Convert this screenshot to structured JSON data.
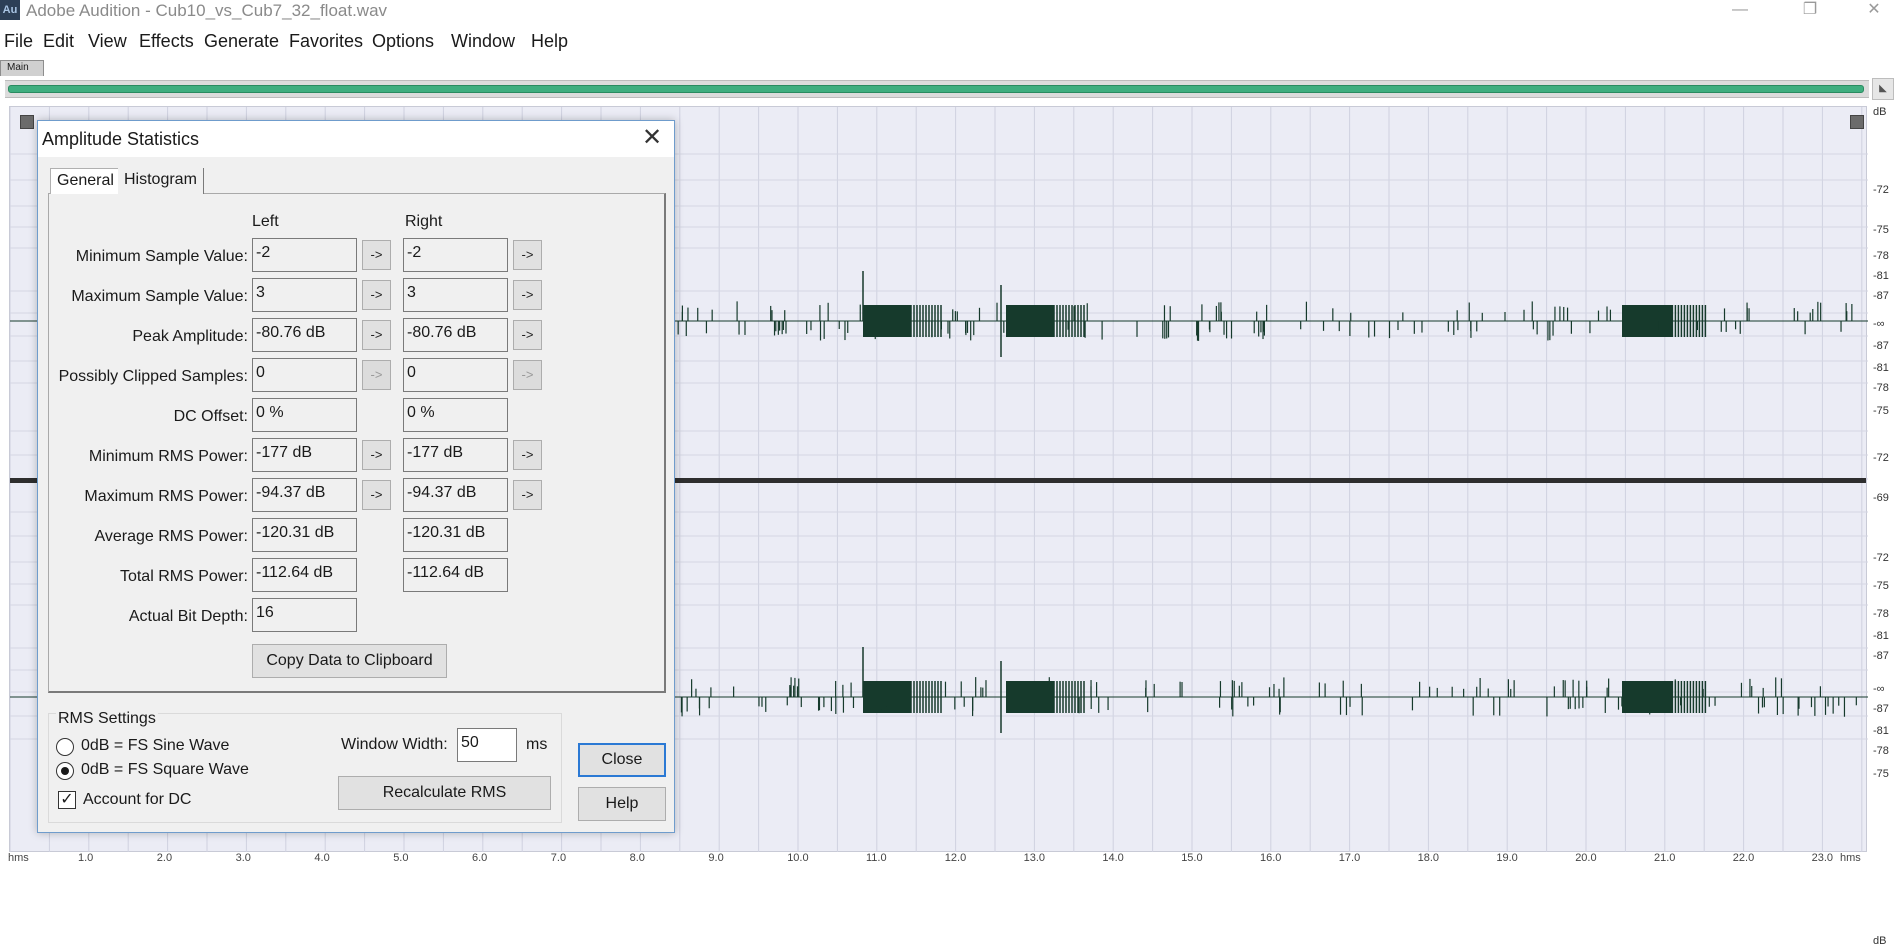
{
  "app": {
    "icon_text": "Au",
    "title": "Adobe Audition - Cub10_vs_Cub7_32_float.wav"
  },
  "window_controls": {
    "minimize": "—",
    "restore": "❐",
    "close": "✕"
  },
  "menu": [
    "File",
    "Edit",
    "View",
    "Effects",
    "Generate",
    "Favorites",
    "Options",
    "Window",
    "Help"
  ],
  "main_tab": "Main",
  "db_ruler": {
    "top_unit": "dB",
    "bottom_unit": "dB",
    "labels": [
      "-72",
      "-75",
      "-78",
      "-81",
      "-87",
      "-∞",
      "-87",
      "-81",
      "-78",
      "-75",
      "-72",
      "-69",
      "-72",
      "-75",
      "-78",
      "-81",
      "-87",
      "-∞",
      "-87",
      "-81",
      "-78",
      "-75"
    ]
  },
  "time_ruler": {
    "labels": [
      "hms",
      "1.0",
      "2.0",
      "3.0",
      "4.0",
      "5.0",
      "6.0",
      "7.0",
      "8.0",
      "9.0",
      "10.0",
      "11.0",
      "12.0",
      "13.0",
      "14.0",
      "15.0",
      "16.0",
      "17.0",
      "18.0",
      "19.0",
      "20.0",
      "21.0",
      "22.0",
      "23.0",
      "hms"
    ]
  },
  "colors": {
    "waveform": "#163a2c",
    "waveform_background": "#ebecf5",
    "overview_range": "#3fae7f",
    "focus_border": "#2b79d4"
  },
  "dialog": {
    "title": "Amplitude Statistics",
    "close_glyph": "✕",
    "tabs": [
      "General",
      "Histogram"
    ],
    "columns": {
      "left": "Left",
      "right": "Right"
    },
    "rows": [
      {
        "label": "Minimum Sample Value:",
        "left": "-2",
        "right": "-2",
        "arrow": "->",
        "arrow_enabled": true
      },
      {
        "label": "Maximum Sample Value:",
        "left": "3",
        "right": "3",
        "arrow": "->",
        "arrow_enabled": true
      },
      {
        "label": "Peak Amplitude:",
        "left": "-80.76 dB",
        "right": "-80.76 dB",
        "arrow": "->",
        "arrow_enabled": true
      },
      {
        "label": "Possibly Clipped Samples:",
        "left": "0",
        "right": "0",
        "arrow": "->",
        "arrow_enabled": false
      },
      {
        "label": "DC Offset:",
        "left": "0 %",
        "right": "0 %",
        "arrow": "",
        "arrow_enabled": false
      },
      {
        "label": "Minimum RMS Power:",
        "left": "-177 dB",
        "right": "-177 dB",
        "arrow": "->",
        "arrow_enabled": true
      },
      {
        "label": "Maximum RMS Power:",
        "left": "-94.37 dB",
        "right": "-94.37 dB",
        "arrow": "->",
        "arrow_enabled": true
      },
      {
        "label": "Average RMS Power:",
        "left": "-120.31 dB",
        "right": "-120.31 dB",
        "arrow": "",
        "arrow_enabled": false
      },
      {
        "label": "Total RMS Power:",
        "left": "-112.64 dB",
        "right": "-112.64 dB",
        "arrow": "",
        "arrow_enabled": false
      },
      {
        "label": "Actual Bit Depth:",
        "left": "16",
        "right": "",
        "arrow": "",
        "arrow_enabled": false
      }
    ],
    "copy_button": "Copy Data to Clipboard",
    "rms_settings": {
      "title": "RMS Settings",
      "option_sine": "0dB = FS Sine Wave",
      "option_square": "0dB = FS Square Wave",
      "selected": "square",
      "account_dc_label": "Account for DC",
      "account_dc_checked": true,
      "checkmark": "✓",
      "window_width_label": "Window Width:",
      "window_width_value": "50",
      "window_width_unit": "ms",
      "recalculate_button": "Recalculate RMS"
    },
    "close_button": "Close",
    "help_button": "Help"
  }
}
